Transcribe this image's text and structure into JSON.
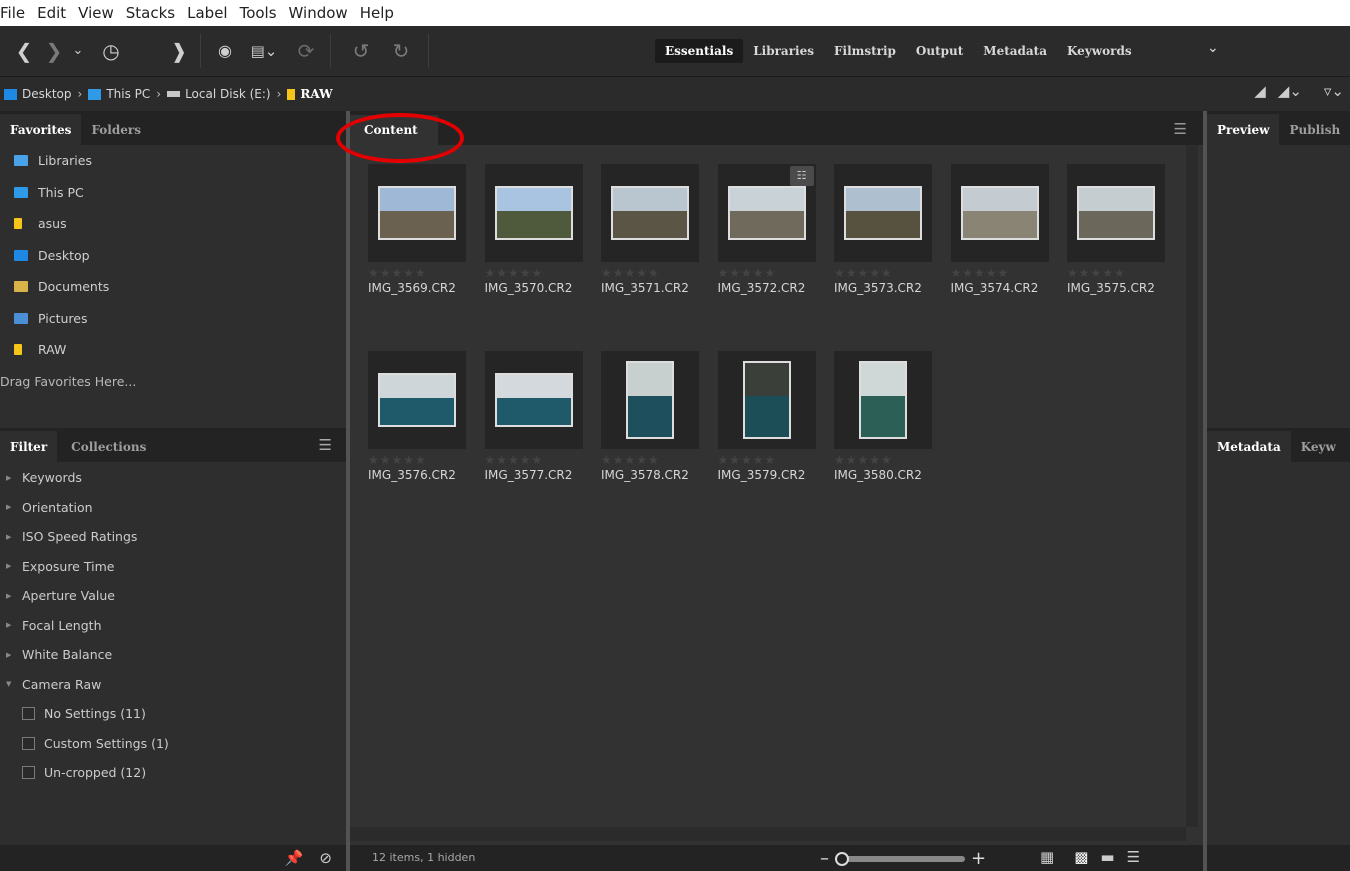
{
  "menu": [
    "File",
    "Edit",
    "View",
    "Stacks",
    "Label",
    "Tools",
    "Window",
    "Help"
  ],
  "workspaces": [
    "Essentials",
    "Libraries",
    "Filmstrip",
    "Output",
    "Metadata",
    "Keywords"
  ],
  "active_workspace": "Essentials",
  "breadcrumb": [
    "Desktop",
    "This PC",
    "Local Disk (E:)",
    "RAW"
  ],
  "left_tabs": [
    "Favorites",
    "Folders"
  ],
  "favorites": [
    "Libraries",
    "This PC",
    "asus",
    "Desktop",
    "Documents",
    "Pictures",
    "RAW"
  ],
  "favorites_drag": "Drag Favorites Here...",
  "filter_tabs": [
    "Filter",
    "Collections"
  ],
  "filters": [
    "Keywords",
    "Orientation",
    "ISO Speed Ratings",
    "Exposure Time",
    "Aperture Value",
    "Focal Length",
    "White Balance",
    "Camera Raw"
  ],
  "camera_raw_options": [
    "No Settings (11)",
    "Custom Settings (1)",
    "Un-cropped (12)"
  ],
  "content_tab": "Content",
  "files": [
    "IMG_3569.CR2",
    "IMG_3570.CR2",
    "IMG_3571.CR2",
    "IMG_3572.CR2",
    "IMG_3573.CR2",
    "IMG_3574.CR2",
    "IMG_3575.CR2",
    "IMG_3576.CR2",
    "IMG_3577.CR2",
    "IMG_3578.CR2",
    "IMG_3579.CR2",
    "IMG_3580.CR2"
  ],
  "status": "12 items, 1 hidden",
  "right_tabs_top": [
    "Preview",
    "Publish"
  ],
  "right_tabs_bottom": [
    "Metadata",
    "Keyw"
  ],
  "colors": {
    "accent_highlight": "#e40000",
    "folder_blue": "#1e88e5",
    "folder_yellow": "#f5c518"
  }
}
